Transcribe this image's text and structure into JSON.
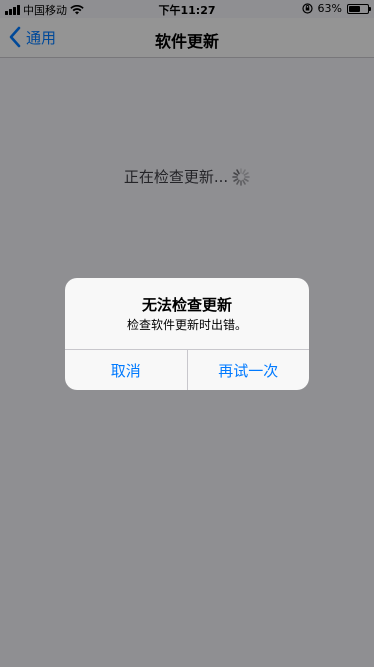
{
  "status_bar": {
    "carrier": "中国移动",
    "time": "下午11:27",
    "battery_percent": "63%",
    "battery_level": 0.63,
    "icons": [
      "signal-icon",
      "wifi-icon",
      "orientation-lock-icon",
      "battery-icon"
    ]
  },
  "nav": {
    "back_label": "通用",
    "title": "软件更新"
  },
  "main": {
    "checking_text": "正在检查更新..."
  },
  "alert": {
    "title": "无法检查更新",
    "message": "检查软件更新时出错。",
    "cancel_label": "取消",
    "retry_label": "再试一次"
  },
  "colors": {
    "accent": "#007aff",
    "background": "#efeff4",
    "dim_overlay": "rgba(0,0,0,0.4)"
  }
}
